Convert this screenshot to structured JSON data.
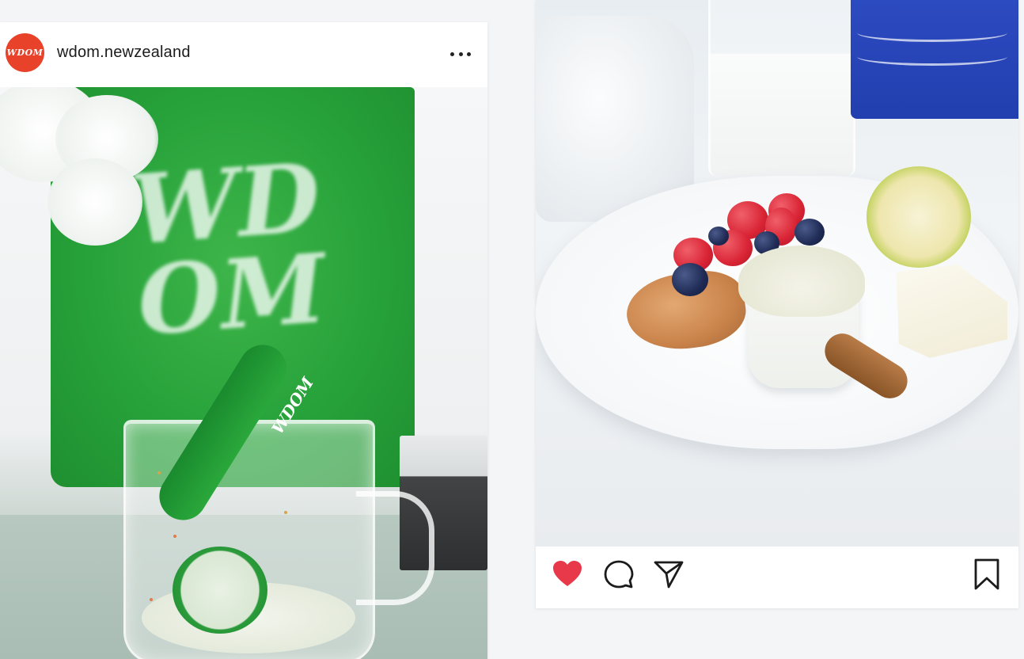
{
  "post_left": {
    "avatar_text": "WDOM",
    "username": "wdom.newzealand",
    "more_icon": "more-horizontal-icon",
    "photo": {
      "bag_wordmark": "WD OM",
      "scoop_label": "WDOM"
    }
  },
  "post_right": {
    "actions": {
      "like_icon": "heart-icon",
      "like_color": "#e8394a",
      "comment_icon": "comment-icon",
      "share_icon": "send-icon",
      "save_icon": "bookmark-icon"
    }
  },
  "colors": {
    "avatar_bg": "#e8422b",
    "bag_green": "#27a23a",
    "box_blue": "#2d4bc0"
  }
}
